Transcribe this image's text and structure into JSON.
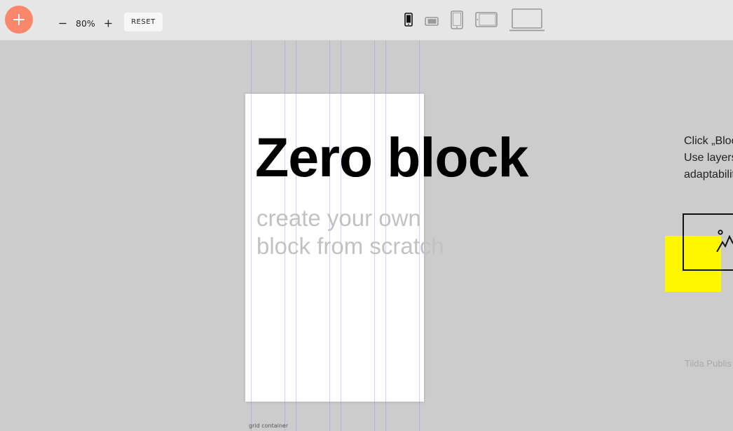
{
  "toolbar": {
    "add_button_icon": "plus-icon",
    "zoom": {
      "minus_icon": "minus-icon",
      "value": "80%",
      "plus_icon": "plus-icon"
    },
    "reset_label": "RESET",
    "devices": [
      {
        "name": "device-phone-portrait",
        "icon": "phone-portrait-icon",
        "active": true
      },
      {
        "name": "device-phone-landscape",
        "icon": "phone-landscape-icon",
        "active": false
      },
      {
        "name": "device-tablet-portrait",
        "icon": "tablet-portrait-icon",
        "active": false
      },
      {
        "name": "device-tablet-landscape",
        "icon": "tablet-landscape-icon",
        "active": false
      },
      {
        "name": "device-desktop",
        "icon": "laptop-icon",
        "active": false
      }
    ]
  },
  "canvas": {
    "title": "Zero block",
    "subtitle_line1": "create your own",
    "subtitle_line2": "block from scratch",
    "grid_container_label": "grid container"
  },
  "hint": {
    "line1": "Click „Bloc",
    "line2": "Use layers",
    "line3": "adaptabilit"
  },
  "publishing_label": "Tilda Publis",
  "colors": {
    "accent": "#fa876b",
    "yellow": "#fff700",
    "toolbar_bg": "#e6e6e6",
    "canvas_bg": "#cccccc"
  }
}
